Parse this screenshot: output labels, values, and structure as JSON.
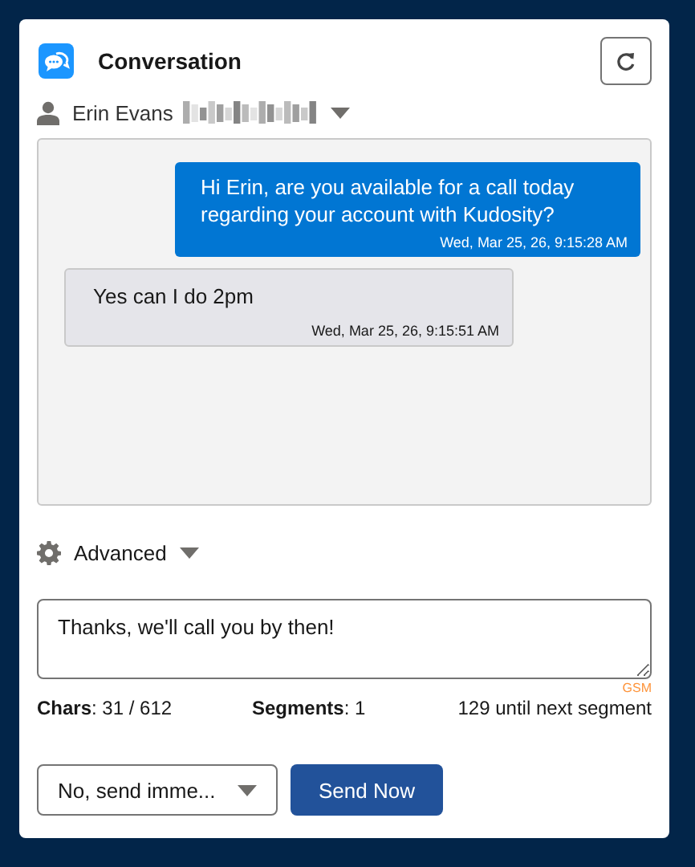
{
  "header": {
    "title": "Conversation"
  },
  "contact": {
    "name": "Erin Evans"
  },
  "messages": [
    {
      "kind": "outgoing",
      "text": "Hi Erin, are you available for a call today regarding your account with Kudosity?",
      "time": "Wed, Mar 25, 26, 9:15:28 AM"
    },
    {
      "kind": "incoming",
      "text": "Yes can I do 2pm",
      "time": "Wed, Mar 25, 26, 9:15:51 AM"
    }
  ],
  "advanced": {
    "label": "Advanced",
    "expanded": false
  },
  "composer": {
    "value": "Thanks, we'll call you by then!",
    "encoding": "GSM"
  },
  "stats": {
    "chars": "**Chars**: 31 / 612",
    "segments": "**Segments**: 1",
    "remaining": "129 until next segment"
  },
  "schedule": {
    "value": "No, send imme..."
  },
  "send_button": "Send Now"
}
